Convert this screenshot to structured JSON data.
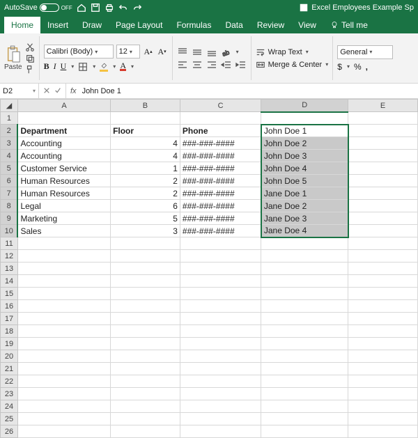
{
  "titlebar": {
    "autosave_label": "AutoSave",
    "autosave_state": "OFF",
    "doc_title": "Excel Employees Example Sp"
  },
  "tabs": [
    "Home",
    "Insert",
    "Draw",
    "Page Layout",
    "Formulas",
    "Data",
    "Review",
    "View"
  ],
  "tellme": "Tell me",
  "ribbon": {
    "paste": "Paste",
    "font_name": "Calibri (Body)",
    "font_size": "12",
    "wrap": "Wrap Text",
    "merge": "Merge & Center",
    "number_format": "General"
  },
  "namebox": "D2",
  "formula_value": "John Doe 1",
  "columns": [
    "A",
    "B",
    "C",
    "D",
    "E"
  ],
  "sheet": {
    "headers": {
      "A": "Department",
      "B": "Floor",
      "C": "Phone"
    },
    "rows": [
      {
        "A": "Accounting",
        "B": "4",
        "C": "###-###-####"
      },
      {
        "A": "Accounting",
        "B": "4",
        "C": "###-###-####"
      },
      {
        "A": "Customer Service",
        "B": "1",
        "C": "###-###-####"
      },
      {
        "A": "Human Resources",
        "B": "2",
        "C": "###-###-####"
      },
      {
        "A": "Human Resources",
        "B": "2",
        "C": "###-###-####"
      },
      {
        "A": "Legal",
        "B": "6",
        "C": "###-###-####"
      },
      {
        "A": "Marketing",
        "B": "5",
        "C": "###-###-####"
      },
      {
        "A": "Sales",
        "B": "3",
        "C": "###-###-####"
      }
    ],
    "dcol": [
      "John Doe 1",
      "John Doe 2",
      "John Doe 3",
      "John Doe 4",
      "John Doe 5",
      "Jane Doe 1",
      "Jane Doe 2",
      "Jane Doe 3",
      "Jane Doe 4"
    ]
  }
}
